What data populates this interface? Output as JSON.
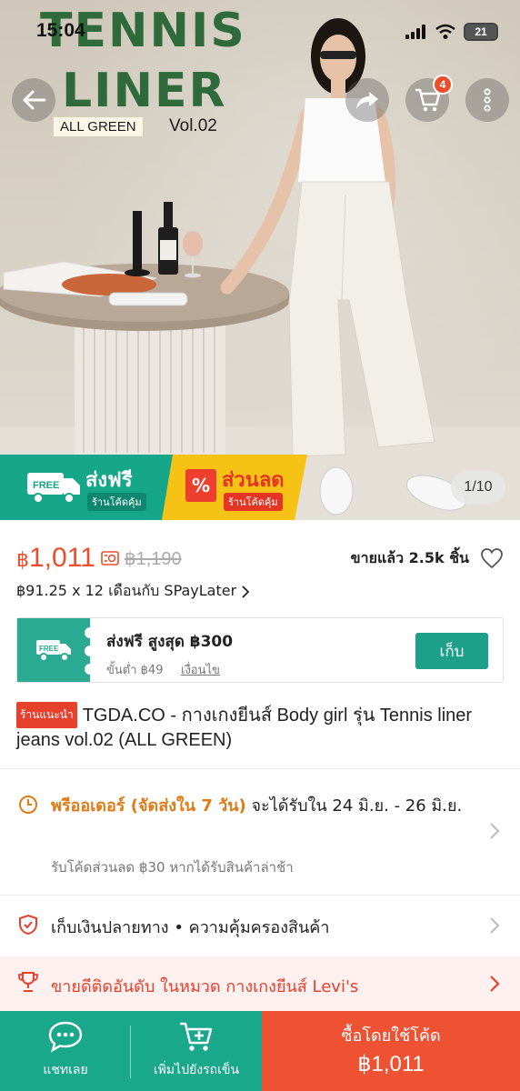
{
  "status_bar": {
    "time": "15:04",
    "battery": "21"
  },
  "hero": {
    "brand_line1": "TENNIS",
    "brand_line2": "LINER",
    "brand_tag": "ALL GREEN",
    "brand_vol": "Vol.02",
    "cart_count": "4",
    "page_counter": "1/10",
    "promo_free": {
      "title": "ส่งฟรี",
      "free_badge": "FREE",
      "sub": "ร้านโค้ดคุ้ม"
    },
    "promo_sale": {
      "title": "ส่วนลด",
      "sub": "ร้านโค้ดคุ้ม",
      "icon_text": "%"
    }
  },
  "price": {
    "currency": "฿",
    "current": "1,011",
    "original": "฿1,190",
    "sold": "ขายแล้ว 2.5k ชิ้น"
  },
  "installment": "฿91.25 x 12 เดือนกับ SPayLater",
  "voucher": {
    "icon_label": "FREE",
    "title": "ส่งฟรี สูงสุด ฿300",
    "min": "ขั้นต่ำ ฿49",
    "conditions": "เงื่อนไข",
    "collect": "เก็บ"
  },
  "product": {
    "shop_badge": "ร้านแนะนำ",
    "title": "TGDA.CO - กางเกงยีนส์ Body girl รุ่น Tennis liner jeans vol.02 (ALL GREEN)"
  },
  "delivery": {
    "preorder": "พรีออเดอร์ (จัดส่งใน 7 วัน)",
    "eta": " จะได้รับใน 24 มิ.ย. - 26 มิ.ย.",
    "late_code": "รับโค้ดส่วนลด ฿30 หากได้รับสินค้าล่าช้า"
  },
  "guarantee": "เก็บเงินปลายทาง  •  ความคุ้มครองสินค้า",
  "bestseller": "ขายดีติดอันดับ ในหมวด กางเกงยีนส์ Levi's",
  "bottom_bar": {
    "chat": "แชทเลย",
    "add_cart": "เพิ่มไปยังรถเข็น",
    "buy_line1": "ซื้อโดยใช้โค้ด",
    "buy_line2": "฿1,011"
  },
  "colors": {
    "brand_green": "#2f6a3a",
    "shopee_orange": "#ee4d2d",
    "teal": "#1aa88d",
    "preorder_orange": "#e07b17"
  }
}
